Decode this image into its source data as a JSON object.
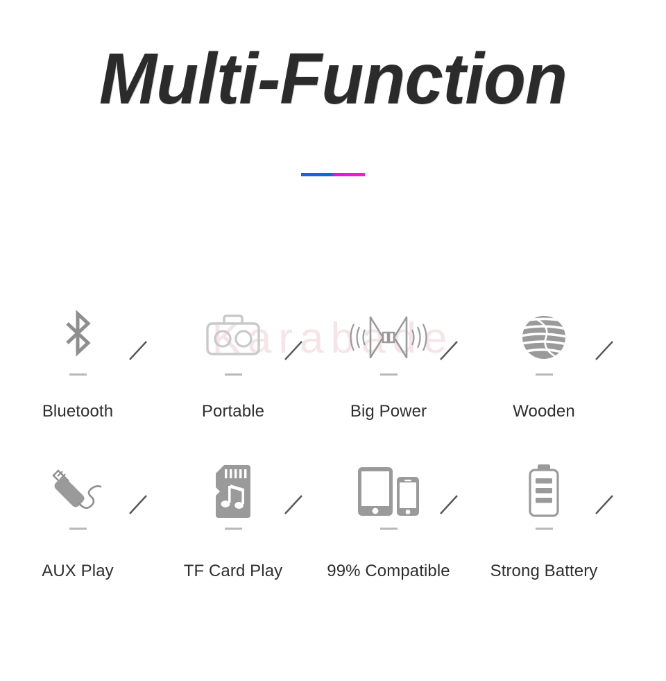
{
  "page": {
    "title": "Multi-Function",
    "background_color": "#ffffff",
    "title_color": "#2b2b2b"
  },
  "divider": {
    "name": "gradient-divider",
    "color_start": "#1565d8",
    "color_end": "#ec1fd8"
  },
  "watermark": {
    "text": "Karabade",
    "color": "#e2aab2"
  },
  "separator": {
    "glyph": "/",
    "color": "#555555"
  },
  "features": {
    "rows": [
      {
        "items": [
          {
            "icon": "bluetooth-icon",
            "label": "Bluetooth"
          },
          {
            "icon": "boombox-icon",
            "label": "Portable"
          },
          {
            "icon": "dual-speaker-icon",
            "label": "Big Power"
          },
          {
            "icon": "wooden-sphere-icon",
            "label": "Wooden"
          }
        ]
      },
      {
        "items": [
          {
            "icon": "audio-jack-icon",
            "label": "AUX Play"
          },
          {
            "icon": "microsd-music-icon",
            "label": "TF Card Play"
          },
          {
            "icon": "tablet-phone-icon",
            "label": "99% Compatible"
          },
          {
            "icon": "battery-icon",
            "label": "Strong Battery"
          }
        ]
      }
    ]
  }
}
